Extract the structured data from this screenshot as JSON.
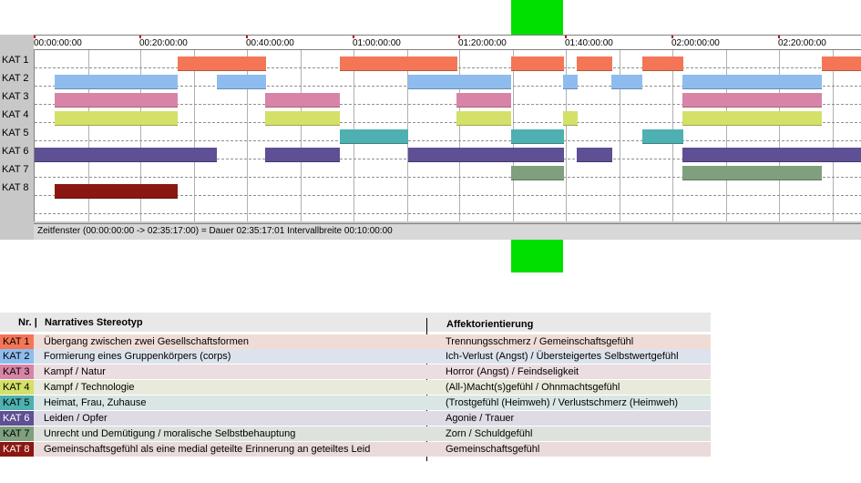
{
  "timeline": {
    "ticks": [
      "00:00:00:00",
      "00:20:00:00",
      "00:40:00:00",
      "01:00:00:00",
      "01:20:00:00",
      "01:40:00:00",
      "02:00:00:00",
      "02:20:00:00"
    ],
    "rows": [
      "KAT 1",
      "KAT 2",
      "KAT 3",
      "KAT 4",
      "KAT 5",
      "KAT 6",
      "KAT 7",
      "KAT 8"
    ],
    "status": "Zeitfenster (00:00:00:00 -> 02:35:17:00) = Dauer 02:35:17:01    Intervallbreite 00:10:00:00"
  },
  "colors": {
    "kat1": "#f47656",
    "kat2": "#8fbcee",
    "kat3": "#d884a7",
    "kat4": "#d4e068",
    "kat5": "#4eb0b0",
    "kat6": "#5f4f94",
    "kat7": "#7f9f7f",
    "kat8": "#8b1712",
    "marker": "#00e000"
  },
  "legend": {
    "header_nr": "Nr. |",
    "header_stereotype": "Narratives Stereotyp",
    "header_affect": "Affektorientierung",
    "rows": [
      {
        "kat": "KAT 1",
        "stereotype": "Übergang zwischen zwei Gesellschaftsformen",
        "affect": "Trennungsschmerz / Gemeinschaftsgefühl"
      },
      {
        "kat": "KAT 2",
        "stereotype": "Formierung eines Gruppenkörpers (corps)",
        "affect": "Ich-Verlust (Angst) / Übersteigertes Selbstwertgefühl"
      },
      {
        "kat": "KAT 3",
        "stereotype": "Kampf / Natur",
        "affect": "Horror (Angst) / Feindseligkeit"
      },
      {
        "kat": "KAT 4",
        "stereotype": "Kampf / Technologie",
        "affect": "(All-)Macht(s)gefühl / Ohnmachtsgefühl"
      },
      {
        "kat": "KAT 5",
        "stereotype": "Heimat, Frau, Zuhause",
        "affect": "(Trostgefühl (Heimweh) / Verlustschmerz (Heimweh)"
      },
      {
        "kat": "KAT 6",
        "stereotype": "Leiden / Opfer",
        "affect": "Agonie / Trauer"
      },
      {
        "kat": "KAT 7",
        "stereotype": "Unrecht und Demütigung / moralische Selbstbehauptung",
        "affect": "Zorn / Schuldgefühl"
      },
      {
        "kat": "KAT 8",
        "stereotype": "Gemeinschaftsgefühl als eine medial geteilte Erinnerung an geteiltes Leid",
        "affect": "Gemeinschaftsgefühl"
      }
    ]
  }
}
